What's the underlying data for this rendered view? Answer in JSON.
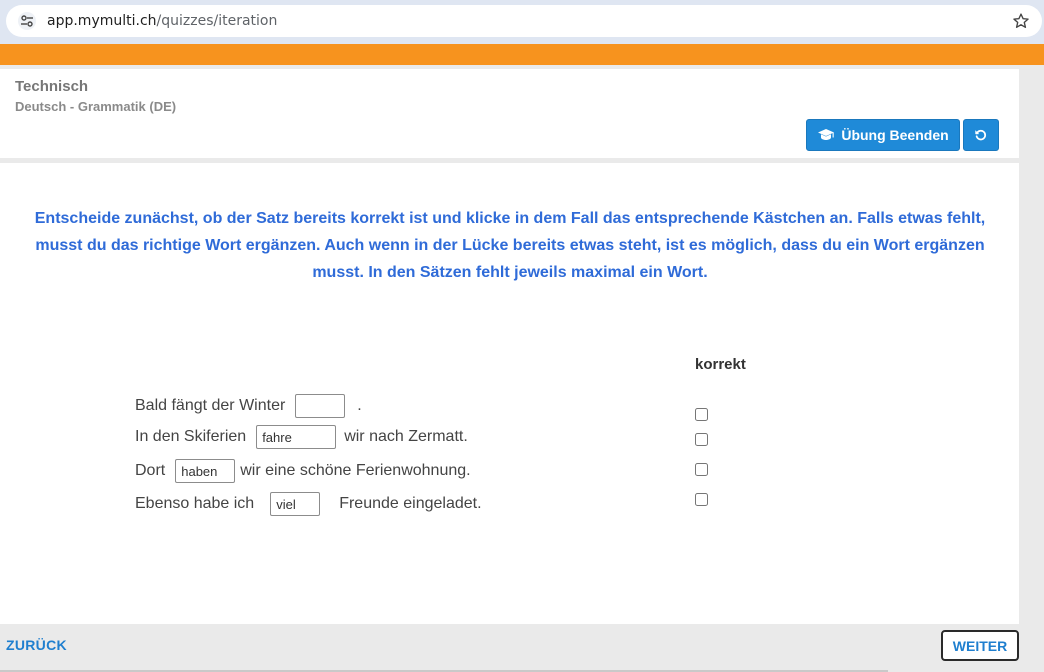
{
  "browser": {
    "url_host": "app.mymulti.ch",
    "url_path": "/quizzes/iteration"
  },
  "header": {
    "title": "Technisch",
    "subtitle": "Deutsch - Grammatik (DE)",
    "end_button_label": "Übung Beenden"
  },
  "instructions": "Entscheide zunächst, ob der Satz bereits korrekt ist und klicke in dem Fall das entsprechende Kästchen an. Falls etwas fehlt, musst du das richtige Wort ergänzen. Auch wenn in der Lücke bereits etwas steht, ist es möglich, dass du ein Wort ergänzen musst. In den Sätzen fehlt jeweils maximal ein Wort.",
  "column_header": "korrekt",
  "sentences": [
    {
      "before": "Bald fängt der Winter",
      "value": "",
      "after": "."
    },
    {
      "before": "In den Skiferien",
      "value": "fahre",
      "after": "wir nach Zermatt."
    },
    {
      "before": "Dort",
      "value": "haben",
      "after": "wir eine schöne Ferienwohnung."
    },
    {
      "before": "Ebenso habe ich",
      "value": "viel",
      "after": "Freunde eingeladet."
    }
  ],
  "footer": {
    "back_label": "ZURÜCK",
    "next_label": "WEITER"
  },
  "colors": {
    "accent": "#f7931e",
    "primary_button": "#1f8ad8",
    "instruction_text": "#2f6bd8",
    "link": "#1f7fcf"
  }
}
